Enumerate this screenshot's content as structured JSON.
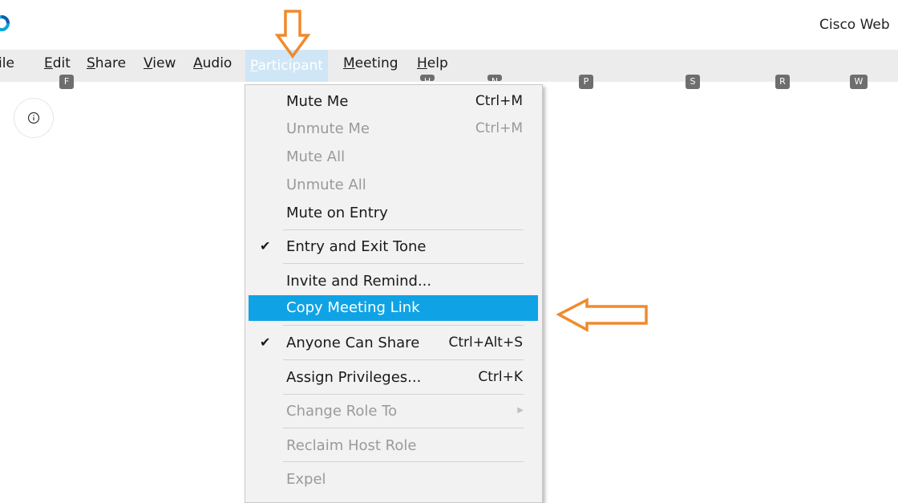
{
  "window": {
    "title": "Cisco Web"
  },
  "menubar": {
    "items": [
      {
        "label": "ile",
        "underline": "",
        "rest": ""
      },
      {
        "label": "Edit",
        "keytip": "F"
      },
      {
        "label": "Share"
      },
      {
        "label": "View"
      },
      {
        "label": "Audio"
      },
      {
        "label": "Participant"
      },
      {
        "label": "Meeting"
      },
      {
        "label": "Help"
      }
    ],
    "keytips": [
      "F",
      "H",
      "N",
      "P",
      "S",
      "R",
      "W"
    ]
  },
  "participant_menu": {
    "items": [
      {
        "label": "Mute Me",
        "shortcut": "Ctrl+M",
        "enabled": true
      },
      {
        "label": "Unmute Me",
        "shortcut": "Ctrl+M",
        "enabled": false
      },
      {
        "label": "Mute All",
        "enabled": false
      },
      {
        "label": "Unmute All",
        "enabled": false
      },
      {
        "label": "Mute on Entry",
        "enabled": true
      },
      {
        "label": "Entry and Exit Tone",
        "checked": true,
        "enabled": true
      },
      {
        "label": "Invite and Remind...",
        "enabled": true
      },
      {
        "label": "Copy Meeting Link",
        "enabled": true,
        "highlighted": true
      },
      {
        "label": "Anyone Can Share",
        "shortcut": "Ctrl+Alt+S",
        "checked": true,
        "enabled": true
      },
      {
        "label": "Assign Privileges...",
        "shortcut": "Ctrl+K",
        "enabled": true
      },
      {
        "label": "Change Role To",
        "enabled": false,
        "submenu": true
      },
      {
        "label": "Reclaim Host Role",
        "enabled": false
      },
      {
        "label": "Expel",
        "enabled": false
      }
    ],
    "check_glyph": "✔"
  },
  "colors": {
    "highlight": "#0fa3e6",
    "annotation_arrow": "#f08a2c",
    "menubar_bg": "#ececec"
  },
  "icons": [
    "webex-logo-icon",
    "info-icon",
    "checkmark-icon",
    "submenu-arrow-icon",
    "annotation-arrow-down-icon",
    "annotation-arrow-left-icon"
  ]
}
